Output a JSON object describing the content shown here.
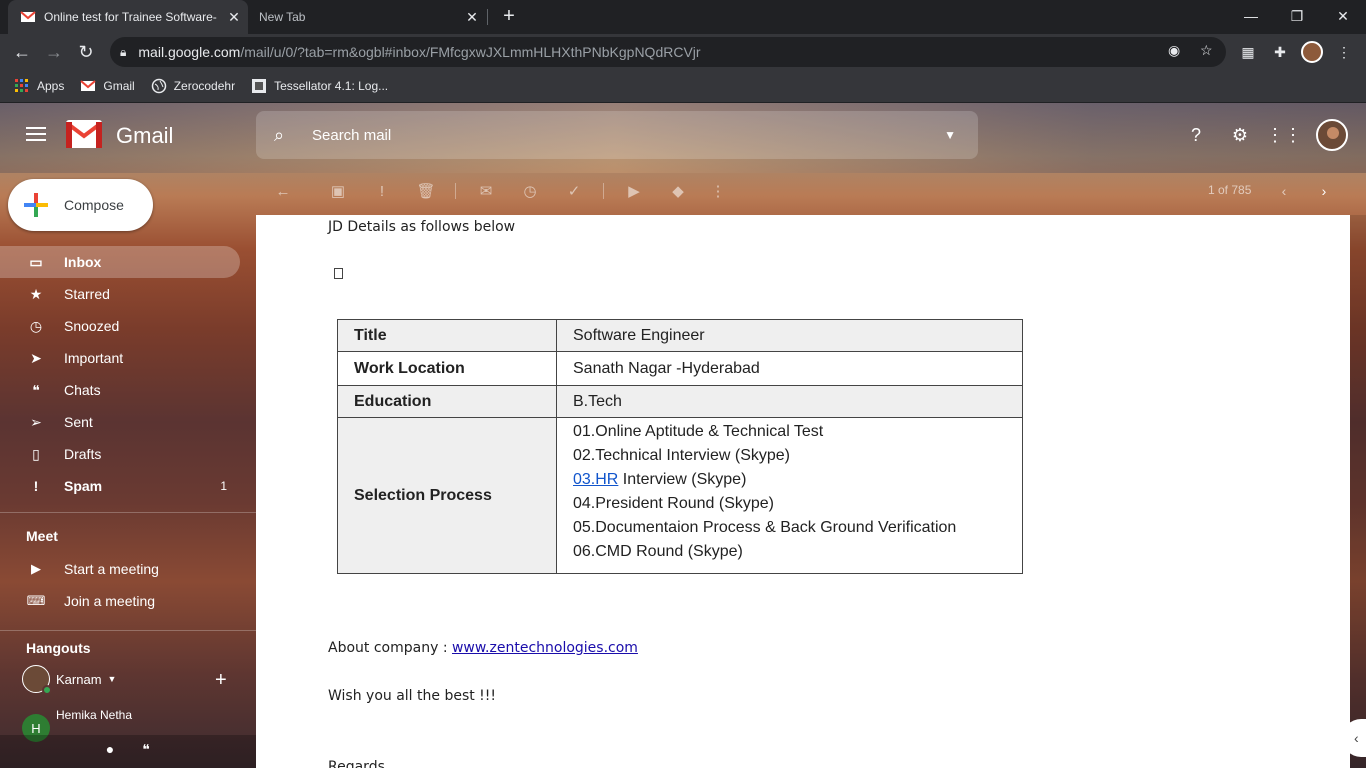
{
  "browser": {
    "tabs": [
      {
        "title": "Online test for Trainee Software-",
        "active": true,
        "favicon": "gmail-icon"
      },
      {
        "title": "New Tab",
        "active": false
      }
    ],
    "url_host": "mail.google.com",
    "url_path": "/mail/u/0/?tab=rm&ogbl#inbox/FMfcgxwJXLmmHLHXthPNbKgpNQdRCVjr",
    "bookmarks": [
      {
        "label": "Apps",
        "icon": "apps-grid-icon"
      },
      {
        "label": "Gmail",
        "icon": "gmail-icon"
      },
      {
        "label": "Zerocodehr",
        "icon": "globe-icon"
      },
      {
        "label": "Tessellator 4.1: Log...",
        "icon": "tessellator-icon"
      }
    ]
  },
  "gmail": {
    "logo_text": "Gmail",
    "search_placeholder": "Search mail",
    "compose_label": "Compose",
    "nav": [
      {
        "label": "Inbox",
        "icon": "inbox-icon",
        "active": true,
        "count": ""
      },
      {
        "label": "Starred",
        "icon": "star-icon",
        "count": ""
      },
      {
        "label": "Snoozed",
        "icon": "clock-icon",
        "count": ""
      },
      {
        "label": "Important",
        "icon": "important-icon",
        "count": ""
      },
      {
        "label": "Chats",
        "icon": "chat-icon",
        "count": ""
      },
      {
        "label": "Sent",
        "icon": "send-icon",
        "count": ""
      },
      {
        "label": "Drafts",
        "icon": "draft-icon",
        "count": ""
      },
      {
        "label": "Spam",
        "icon": "spam-icon",
        "count": "1"
      }
    ],
    "meet": {
      "heading": "Meet",
      "items": [
        {
          "label": "Start a meeting",
          "icon": "video-icon"
        },
        {
          "label": "Join a meeting",
          "icon": "keyboard-icon"
        }
      ]
    },
    "hangouts": {
      "heading": "Hangouts",
      "user": "Karnam",
      "contact_name": "Hemika Netha",
      "contact_initial": "H"
    },
    "pager": "1 of 785",
    "accent_colors": {
      "red": "#ea4335",
      "blue": "#4285f4",
      "yellow": "#fbbc04",
      "green": "#34a853"
    }
  },
  "email": {
    "intro": "JD Details as follows below",
    "table": [
      {
        "key": "Title",
        "value": "Software Engineer"
      },
      {
        "key": "Work Location",
        "value": "Sanath Nagar -Hyderabad"
      },
      {
        "key": "Education",
        "value": "B.Tech"
      }
    ],
    "selection": {
      "key": "Selection Process",
      "lines": [
        "01.Online Aptitude & Technical Test",
        "02.Technical Interview (Skype)",
        "04.President Round (Skype)",
        "05.Documentaion Process & Back Ground Verification",
        "06.CMD Round (Skype)"
      ],
      "hr_link": "03.HR",
      "hr_rest": " Interview (Skype)"
    },
    "about_prefix": "About company : ",
    "about_link": "www.zentechnologies.com",
    "wish": "Wish you all the best !!!",
    "signoff": "Regards"
  }
}
